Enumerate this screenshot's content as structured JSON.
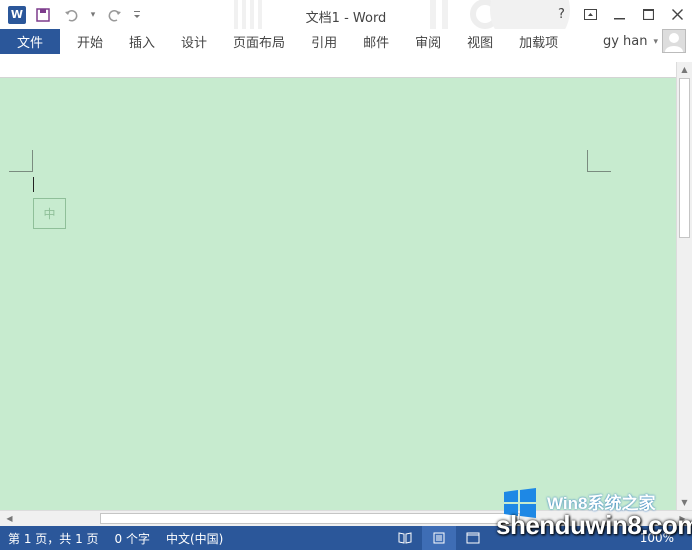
{
  "window": {
    "title": "文档1 - Word",
    "controls": [
      "?",
      "ribbon-display-options",
      "minimize",
      "maximize",
      "close"
    ]
  },
  "quick_access": {
    "items": [
      "word-logo",
      "save",
      "undo",
      "redo",
      "customize"
    ]
  },
  "ribbon": {
    "file_tab": "文件",
    "tabs": [
      "开始",
      "插入",
      "设计",
      "页面布局",
      "引用",
      "邮件",
      "审阅",
      "视图",
      "加载项"
    ],
    "user_name": "gy han"
  },
  "document": {
    "background": "#c7ebcf",
    "ime_indicator": "中"
  },
  "status_bar": {
    "page_info": "第 1 页，共 1 页",
    "word_count": "0 个字",
    "language": "中文(中国)",
    "zoom": "100%"
  },
  "watermark": {
    "line1": "Win8系统之家",
    "line2": "shenduwin8.com"
  },
  "colors": {
    "accent": "#2b579a",
    "document_bg": "#c7ebcf"
  }
}
